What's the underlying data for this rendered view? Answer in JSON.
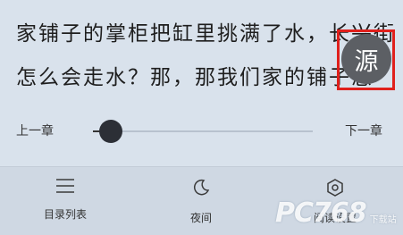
{
  "content": {
    "line1": "家铺子的掌柜把缸里挑满了水，长兴街",
    "line2": "怎么会走水？那，那我们家的铺子怎"
  },
  "source_button": {
    "label": "源"
  },
  "chapter": {
    "prev_label": "上一章",
    "next_label": "下一章",
    "progress": 0.08
  },
  "bottom_nav": {
    "toc_label": "目录列表",
    "night_label": "夜间",
    "settings_label": "阅读设置"
  },
  "watermark": {
    "text": "PC768",
    "sub": "下载站"
  }
}
